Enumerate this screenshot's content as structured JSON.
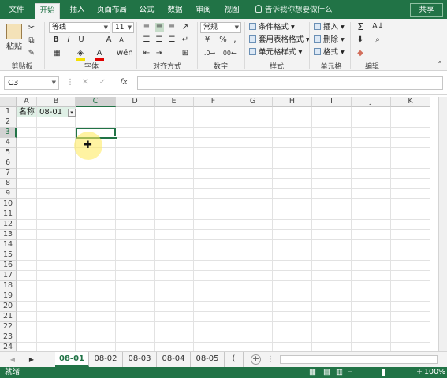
{
  "ribbon_tabs": [
    "文件",
    "开始",
    "插入",
    "页面布局",
    "公式",
    "数据",
    "审阅",
    "视图"
  ],
  "active_tab": "开始",
  "tell_me": "告诉我你想要做什么",
  "share": "共享",
  "clipboard": {
    "paste": "粘贴",
    "label": "剪贴板"
  },
  "font": {
    "name": "等线",
    "size": "11",
    "bold": "B",
    "italic": "I",
    "underline": "U",
    "label": "字体"
  },
  "alignment": {
    "label": "对齐方式"
  },
  "number": {
    "format": "常规",
    "percent": "%",
    "comma": ",",
    "label": "数字"
  },
  "styles": {
    "conditional": "条件格式",
    "table": "套用表格格式",
    "cell": "单元格样式",
    "label": "样式"
  },
  "cells": {
    "insert": "插入",
    "delete": "删除",
    "format": "格式",
    "label": "单元格"
  },
  "editing": {
    "label": "编辑"
  },
  "name_box": "C3",
  "fx": "fx",
  "columns": [
    "A",
    "B",
    "C",
    "D",
    "E",
    "F",
    "G",
    "H",
    "I",
    "J",
    "K"
  ],
  "rows": [
    "1",
    "2",
    "3",
    "4",
    "5",
    "6",
    "7",
    "8",
    "9",
    "10",
    "11",
    "12",
    "13",
    "14",
    "15",
    "16",
    "17",
    "18",
    "19",
    "20",
    "21",
    "22",
    "23",
    "24"
  ],
  "cells_data": {
    "A1": "名称",
    "B1": "08-01"
  },
  "sheets": [
    "08-01",
    "08-02",
    "08-03",
    "08-04",
    "08-05",
    "("
  ],
  "active_sheet": "08-01",
  "status": {
    "ready": "就绪",
    "zoom": "100%"
  },
  "colors": {
    "accent": "#217346",
    "selection": "#217346",
    "header_fill": "#dff0e6"
  }
}
